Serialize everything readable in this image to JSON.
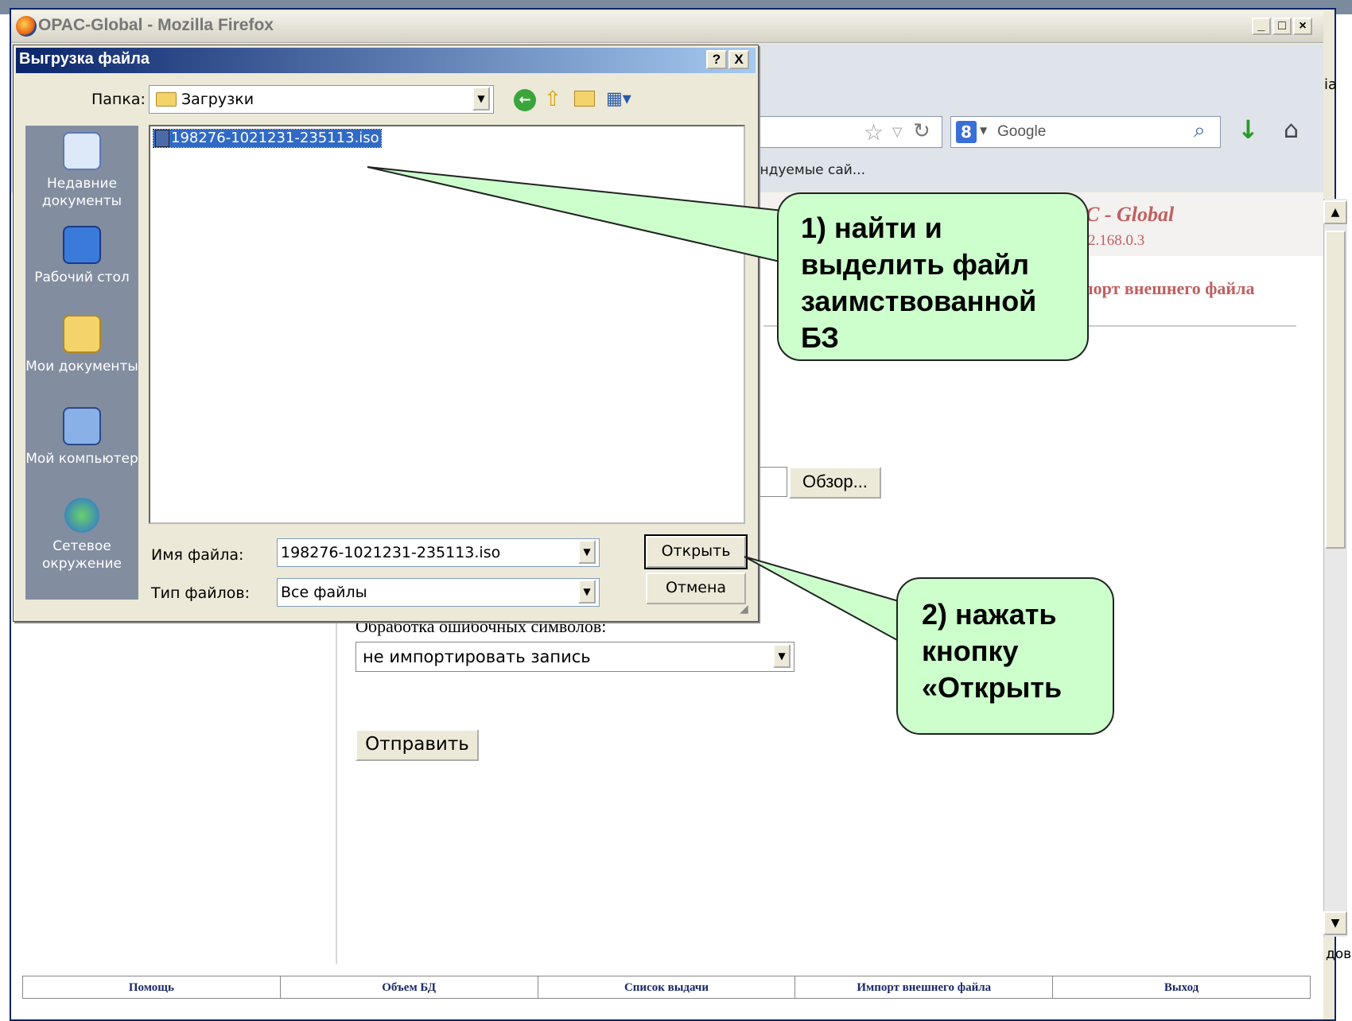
{
  "browser": {
    "title": "OPAC-Global - Mozilla Firefox",
    "search_engine_placeholder": "Google",
    "bookmarks_item": "Рекомендуемые сай...",
    "side_snippet_1": "іа",
    "side_snippet_2": "дов"
  },
  "page": {
    "brand": "C - Global",
    "ip": "2.168.0.3",
    "heading": "порт внешнего файла",
    "browse_button": "Обзор...",
    "error_label": "Обработка ошибочных символов:",
    "error_select_value": "не импортировать запись",
    "submit_button": "Отправить"
  },
  "footer_nav": [
    "Помощь",
    "Объем БД",
    "Список выдачи",
    "Импорт внешнего файла",
    "Выход"
  ],
  "dialog": {
    "title": "Выгрузка файла",
    "help_button": "?",
    "close_button": "X",
    "folder_label": "Папка:",
    "folder_value": "Загрузки",
    "places": [
      {
        "label": "Недавние документы",
        "icon": "recent-documents-icon"
      },
      {
        "label": "Рабочий стол",
        "icon": "desktop-icon"
      },
      {
        "label": "Мои документы",
        "icon": "my-documents-icon"
      },
      {
        "label": "Мой компьютер",
        "icon": "my-computer-icon"
      },
      {
        "label": "Сетевое окружение",
        "icon": "network-icon"
      }
    ],
    "files": [
      "198276-1021231-235113.iso"
    ],
    "filename_label": "Имя файла:",
    "filename_value": "198276-1021231-235113.iso",
    "filetype_label": "Тип файлов:",
    "filetype_value": "Все файлы",
    "open_button": "Открыть",
    "cancel_button": "Отмена"
  },
  "callouts": {
    "step1": "1) найти и выделить файл заимствованной БЗ",
    "step2": "2) нажать кнопку «Открыть"
  },
  "colors": {
    "dialog_title_gradient_start": "#0a246a",
    "callout_fill": "#ccffcc",
    "selection": "#316ac5",
    "page_accent": "#c06060"
  }
}
